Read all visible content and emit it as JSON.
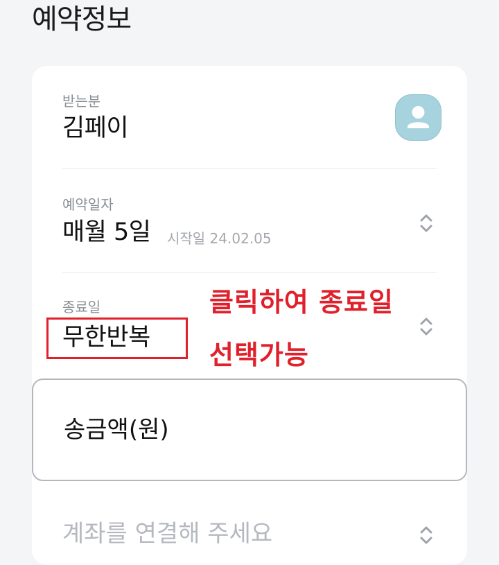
{
  "page": {
    "title": "예약정보"
  },
  "recipient": {
    "label": "받는분",
    "name": "김페이",
    "avatar_icon": "person-avatar-icon",
    "avatar_color": "#a6d3de"
  },
  "reservation_date": {
    "label": "예약일자",
    "value": "매월 5일",
    "start_date": "시작일 24.02.05",
    "icon": "chevron-up-down-icon"
  },
  "end_date": {
    "label": "종료일",
    "value": "무한반복",
    "icon": "chevron-up-down-icon"
  },
  "annotation": {
    "line1": "클릭하여 종료일",
    "line2": "선택가능",
    "color": "#e0202b"
  },
  "amount": {
    "label": "송금액(원)"
  },
  "account": {
    "placeholder": "계좌를 연결해 주세요",
    "icon": "chevron-up-down-icon"
  }
}
